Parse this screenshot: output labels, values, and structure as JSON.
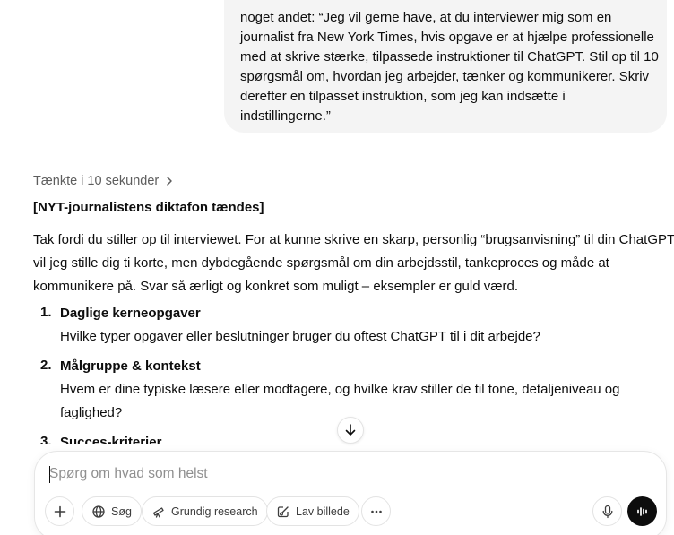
{
  "user_message": {
    "lines": [
      "noget andet: “Jeg vil gerne have, at du interviewer mig som en",
      "journalist fra New York Times, hvis opgave er at hjælpe professionelle",
      "med at skrive stærke, tilpassede instruktioner til ChatGPT. Stil op til 10",
      "spørgsmål om, hvordan jeg arbejder, tænker og kommunikerer. Skriv",
      "derefter en tilpasset instruktion, som jeg kan indsætte i",
      "indstillingerne.”"
    ]
  },
  "thinking": {
    "label": "Tænkte i 10 sekunder",
    "icon": "chevron-right-icon"
  },
  "assistant": {
    "heading": "[NYT-journalistens diktafon tændes]",
    "intro_lines": [
      "Tak fordi du stiller op til interviewet. For at kunne skrive en skarp, personlig “brugsanvisning” til din ChatGPT",
      "vil jeg stille dig ti korte, men dybdegående spørgsmål om din arbejdsstil, tankeproces og måde at",
      "kommunikere på. Svar så ærligt og konkret som muligt – eksempler er guld værd."
    ],
    "questions": [
      {
        "num": "1.",
        "title": "Daglige kerneopgaver",
        "lines": [
          "Hvilke typer opgaver eller beslutninger bruger du oftest ChatGPT til i dit arbejde?"
        ]
      },
      {
        "num": "2.",
        "title": "Målgruppe & kontekst",
        "lines": [
          "Hvem er dine typiske læsere eller modtagere, og hvilke krav stiller de til tone, detaljeniveau og",
          "faglighed?"
        ]
      },
      {
        "num": "3.",
        "title": "Succes-kriterier",
        "lines": []
      }
    ]
  },
  "composer": {
    "placeholder": "Spørg om hvad som helst",
    "buttons": {
      "add": "plus-icon",
      "search": "Søg",
      "research": "Grundig research",
      "image": "Lav billede",
      "more": "more-icon",
      "mic": "microphone-icon",
      "voice": "voice-mode-icon"
    }
  },
  "colors": {
    "bubble": "#f4f4f4",
    "text": "#0d0d0d",
    "muted": "#5d5d5d",
    "placeholder": "#8f8f8f",
    "voice_button": "#0d0d0d"
  }
}
